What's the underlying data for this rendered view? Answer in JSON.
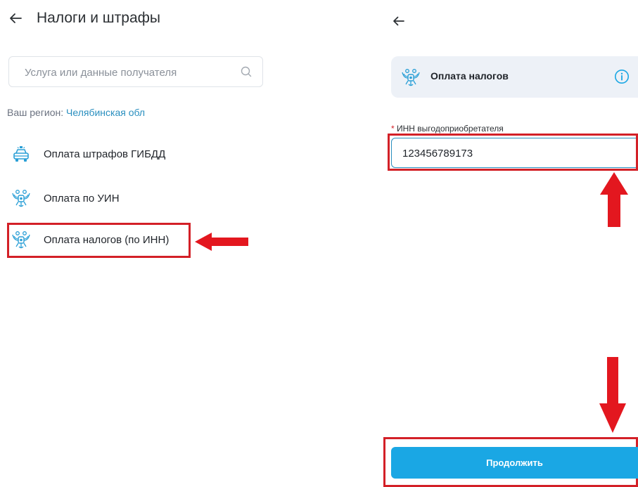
{
  "left_screen": {
    "title": "Налоги и штрафы",
    "search": {
      "placeholder": "Услуга или данные получателя"
    },
    "region": {
      "label": "Ваш регион:",
      "value": "Челябинская обл"
    },
    "items": [
      {
        "label": "Оплата штрафов ГИБДД",
        "icon": "police-car-icon"
      },
      {
        "label": "Оплата по УИН",
        "icon": "eagle-emblem-icon"
      },
      {
        "label": "Оплата налогов (по ИНН)",
        "icon": "eagle-emblem-icon"
      }
    ]
  },
  "right_screen": {
    "service_card": {
      "title": "Оплата налогов",
      "icon": "eagle-emblem-icon"
    },
    "inn_field": {
      "required_mark": "*",
      "label": "ИНН выгодоприобретателя",
      "value": "123456789173"
    },
    "continue_label": "Продолжить"
  },
  "colors": {
    "accent": "#1aa7e4",
    "link": "#2a8fbf",
    "highlight": "#d32027",
    "card_bg": "#edf1f7"
  }
}
